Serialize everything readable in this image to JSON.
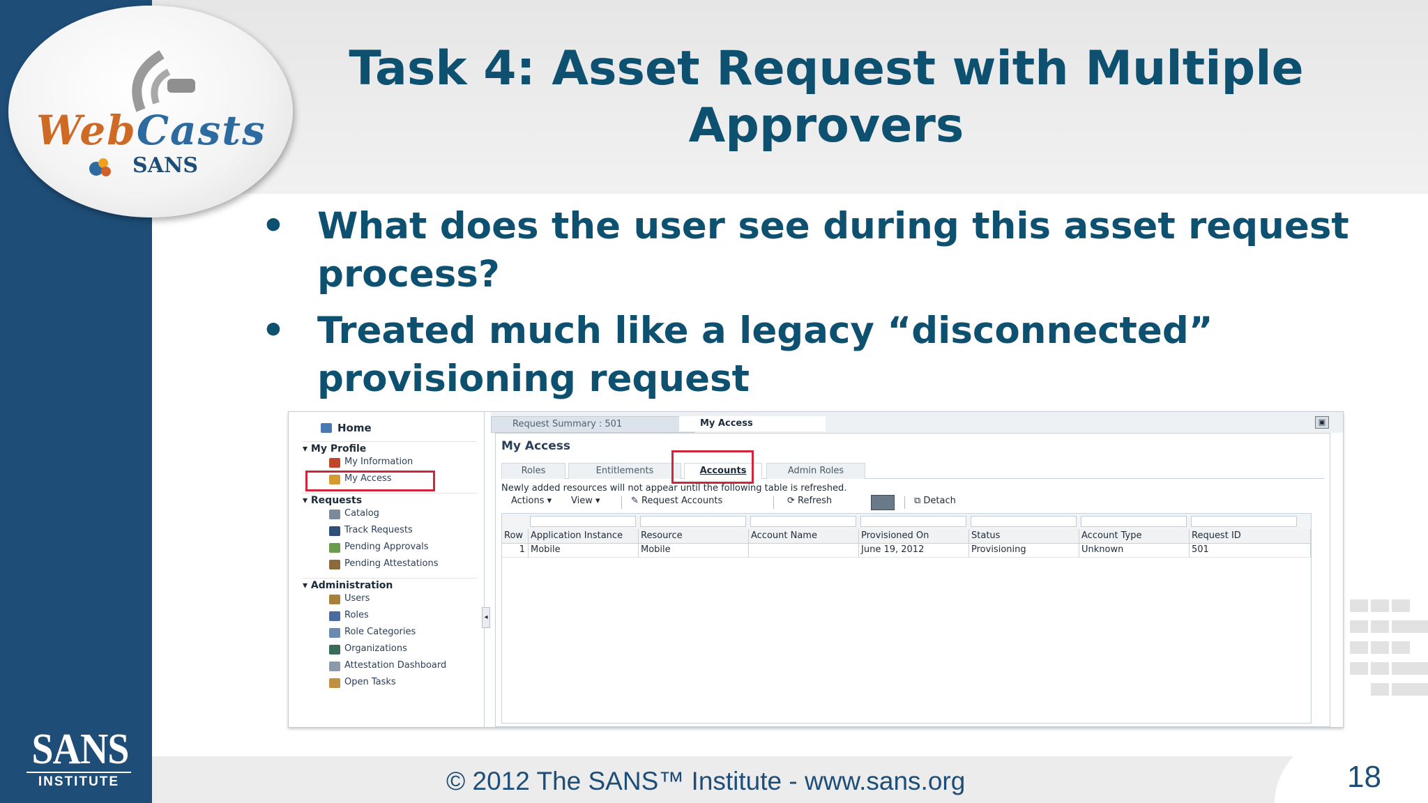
{
  "slide": {
    "title": "Task 4: Asset Request with Multiple Approvers",
    "bullets": [
      "What does the user see during this asset request process?",
      "Treated much like a legacy “disconnected” provisioning request"
    ],
    "footer": "© 2012 The SANS™ Institute - www.sans.org",
    "page_number": "18",
    "logo": {
      "webcasts_web": "Web",
      "webcasts_casts": "Casts",
      "webcasts_sans": "SANS",
      "institute_big": "SANS",
      "institute_small": "INSTITUTE"
    }
  },
  "screenshot": {
    "nav": {
      "home": "Home",
      "sections": [
        {
          "label": "My Profile",
          "items": [
            "My Information",
            "My Access"
          ]
        },
        {
          "label": "Requests",
          "items": [
            "Catalog",
            "Track Requests",
            "Pending Approvals",
            "Pending Attestations"
          ]
        },
        {
          "label": "Administration",
          "items": [
            "Users",
            "Roles",
            "Role Categories",
            "Organizations",
            "Attestation Dashboard",
            "Open Tasks"
          ]
        }
      ]
    },
    "top_tabs": [
      "Request Summary : 501",
      "My Access"
    ],
    "panel_title": "My Access",
    "sub_tabs": [
      "Roles",
      "Entitlements",
      "Accounts",
      "Admin Roles"
    ],
    "notice": "Newly added resources will not appear until the following table is refreshed.",
    "toolbar": {
      "actions": "Actions",
      "view": "View",
      "request_accounts": "Request Accounts",
      "refresh": "Refresh",
      "detach": "Detach"
    },
    "table": {
      "columns": [
        "Row",
        "Application Instance",
        "Resource",
        "Account Name",
        "Provisioned On",
        "Status",
        "Account Type",
        "Request ID"
      ],
      "rows": [
        [
          "1",
          "Mobile",
          "Mobile",
          "",
          "June 19, 2012",
          "Provisioning",
          "Unknown",
          "501"
        ]
      ]
    },
    "colors": {
      "highlight": "#d1263a",
      "title": "#0e5070",
      "sidebar": "#1e4e78"
    }
  }
}
